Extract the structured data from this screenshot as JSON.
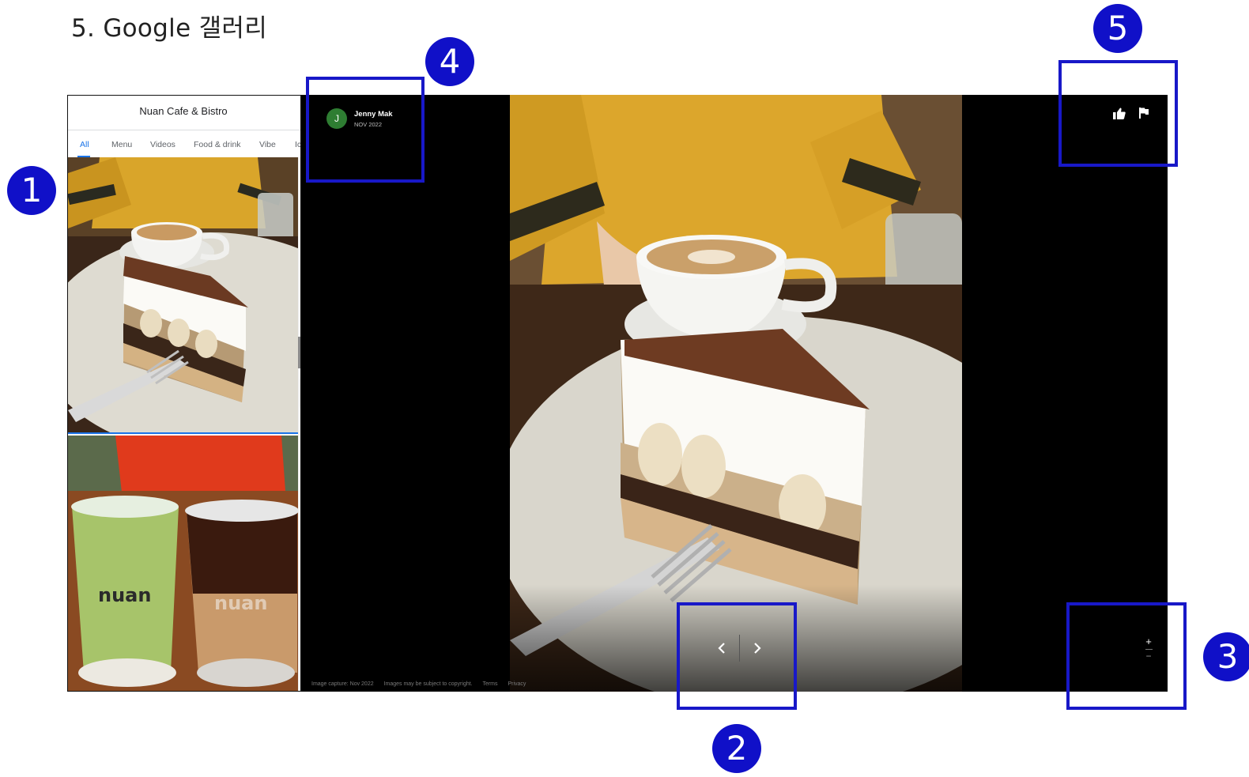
{
  "slide": {
    "title": "5. Google 갤러리"
  },
  "panel": {
    "title": "Nuan Cafe & Bistro",
    "tabs": [
      {
        "label": "All",
        "active": true
      },
      {
        "label": "Menu"
      },
      {
        "label": "Videos"
      },
      {
        "label": "Food & drink"
      },
      {
        "label": "Vibe"
      },
      {
        "label": "Ic"
      }
    ]
  },
  "photo_labels": {
    "cup_left": "nuan",
    "cup_right": "nuan"
  },
  "viewer": {
    "author": {
      "initial": "J",
      "name": "Jenny Mak",
      "date": "NOV 2022"
    },
    "footer": {
      "capture": "Image capture: Nov 2022",
      "copyright": "Images may be subject to copyright.",
      "terms": "Terms",
      "privacy": "Privacy"
    },
    "zoom": {
      "plus": "+",
      "minus": "−"
    }
  },
  "icons": {
    "like": "thumbs-up-icon",
    "report": "flag-icon",
    "prev": "chevron-left-icon",
    "next": "chevron-right-icon",
    "collapse": "caret-left-icon"
  },
  "annotations": [
    "1",
    "2",
    "3",
    "4",
    "5"
  ],
  "colors": {
    "annotation": "#1818c8",
    "badge": "#1010c8",
    "accent": "#1a73e8",
    "avatar": "#2e7d32"
  }
}
